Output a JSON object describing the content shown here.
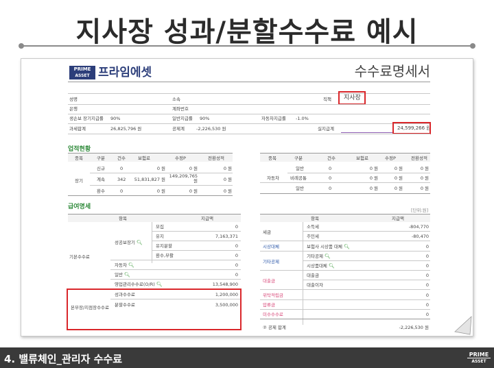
{
  "slide": {
    "title": "지사장 성과/분할수수료 예시",
    "footer": "4. 밸류체인_관리자 수수료",
    "logo": [
      "PRIME",
      "ASSET"
    ]
  },
  "doc": {
    "brand_logo": [
      "PRIME",
      "ASSET"
    ],
    "brand_name": "프라임에셋",
    "title": "수수료명세서",
    "info": {
      "name_label": "성명",
      "affil_label": "소속",
      "position_label": "직책",
      "position_value": "지사장",
      "bank_label": "은행",
      "account_label": "계좌번호",
      "rate1_label": "생손보 장기지급률",
      "rate1_value": "90%",
      "rate2_label": "일반지급률",
      "rate2_value": "90%",
      "rate3_label": "자동차지급률",
      "rate3_value": "-1.0%",
      "tax_label": "과세합계",
      "tax_value": "26,825,796 원",
      "deduct_label": "공제계",
      "deduct_value": "-2,226,530 원",
      "pay_label": "실지급계",
      "pay_value": "24,599,266 원"
    },
    "perf": {
      "section": "업적현황",
      "headers": [
        "종목",
        "구분",
        "건수",
        "보험료",
        "수정P",
        "전환성적"
      ],
      "left_rows": [
        [
          "",
          "신규",
          "0",
          "0 원",
          "0 원",
          "0 원"
        ],
        [
          "장기",
          "계속",
          "342",
          "51,831,827 원",
          "149,209,765 원",
          "0 원"
        ],
        [
          "",
          "환수",
          "0",
          "0 원",
          "0 원",
          "0 원"
        ]
      ],
      "right_rows": [
        [
          "",
          "일반",
          "0",
          "0 원",
          "0 원",
          "0 원"
        ],
        [
          "자동차",
          "비례공통",
          "0",
          "0 원",
          "0 원",
          "0 원"
        ],
        [
          "",
          "일반",
          "0",
          "0 원",
          "0 원",
          "0 원"
        ]
      ]
    },
    "pay": {
      "section": "급여명세",
      "unit": "[단위:원]",
      "headers": [
        "항목",
        "지급액"
      ],
      "left_group1": "기본수수료",
      "left_subgroup": "성공보장기",
      "left_rows": [
        [
          "모집",
          "0"
        ],
        [
          "유지",
          "7,163,371"
        ],
        [
          "유지분할",
          "0"
        ],
        [
          "환수,부활",
          "0"
        ]
      ],
      "left_single": [
        [
          "자동차",
          "0"
        ],
        [
          "일반",
          "0"
        ],
        [
          "영업관리수수료(O/R)",
          "13,548,900"
        ]
      ],
      "left_group2": "본부장/지점장수수료",
      "left_highlight": [
        [
          "성과수수료",
          "1,200,000"
        ],
        [
          "분할수수료",
          "3,500,000"
        ]
      ],
      "right_headers": [
        "항목",
        "지급액"
      ],
      "right_rows": [
        [
          "세금",
          "소득세",
          "-804,770"
        ],
        [
          "",
          "주민세",
          "-80,470"
        ],
        [
          "시상대체",
          "보험사 시상품 대체",
          "0"
        ],
        [
          "기타공제",
          "기타공제",
          "0"
        ],
        [
          "",
          "시상품대체",
          "0"
        ],
        [
          "대출금",
          "대출금",
          "0"
        ],
        [
          "",
          "대출이자",
          "0"
        ],
        [
          "위탁적립금",
          "",
          "0"
        ],
        [
          "압류금",
          "",
          "0"
        ],
        [
          "미수수수료",
          "",
          "0"
        ]
      ],
      "deduct_total_label": "② 공제 합계",
      "deduct_total_value": "-2,226,530 원"
    }
  }
}
